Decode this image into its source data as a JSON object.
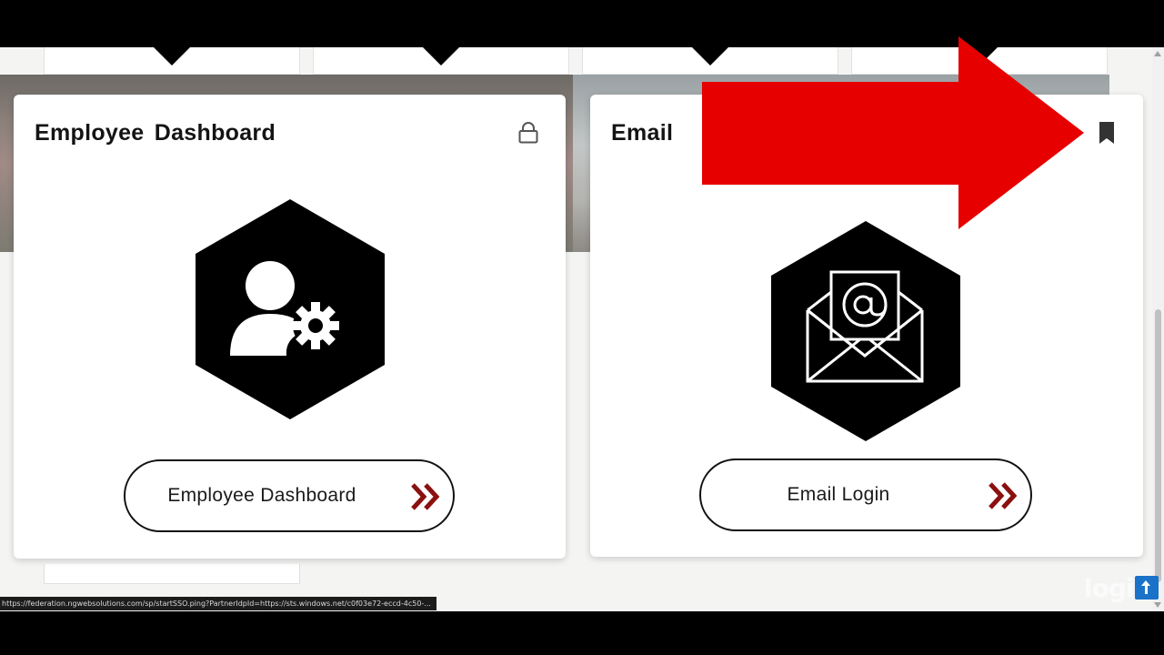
{
  "cards": [
    {
      "title": "Employee  Dashboard",
      "icon": "employee-settings-icon",
      "status_icon": "lock-icon",
      "button_label": "Employee Dashboard"
    },
    {
      "title": "Email",
      "icon": "email-at-icon",
      "status_icon": "bookmark-icon",
      "button_label": "Email Login"
    }
  ],
  "status_bar": {
    "url": "https://federation.ngwebsolutions.com/sp/startSSO.ping?PartnerIdpId=https://sts.windows.net/c0f03e72-eccd-4c50-..."
  },
  "watermark": {
    "text": "logi"
  },
  "colors": {
    "accent_chevron": "#8b1010",
    "annotation_arrow": "#e60000",
    "card_background": "#ffffff",
    "hex_fill": "#000000"
  }
}
